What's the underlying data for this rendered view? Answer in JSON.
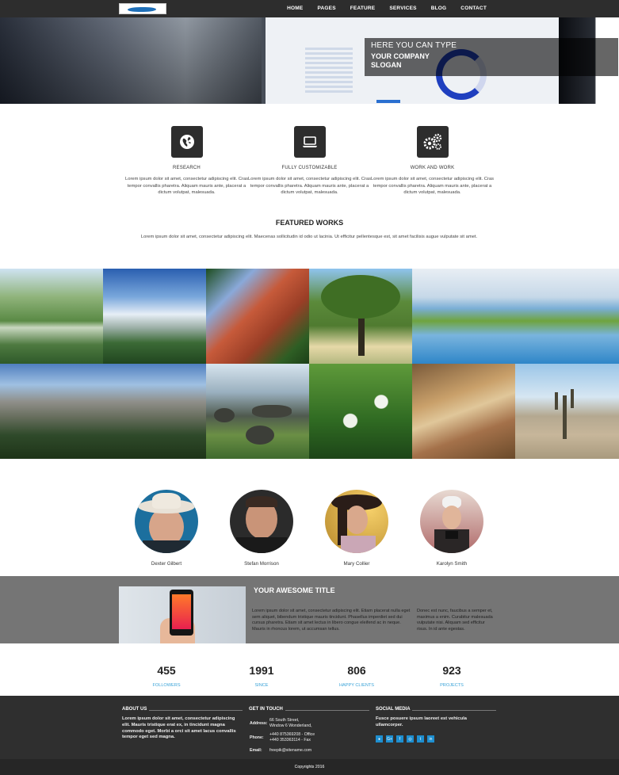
{
  "nav": {
    "menu": [
      "HOME",
      "PAGES",
      "FEATURE",
      "SERVICES",
      "BLOG",
      "CONTACT"
    ]
  },
  "hero": {
    "line1": "HERE YOU CAN TYPE",
    "line2": "YOUR COMPANY SLOGAN"
  },
  "features": [
    {
      "icon": "globe-icon",
      "title": "RESEARCH",
      "text": "Lorem ipsum dolor sit amet, consectetur adipiscing elit. Cras tempor convallis pharetra. Aliquam mauris ante, placerat a dictum volutpat, malesuada."
    },
    {
      "icon": "laptop-icon",
      "title": "FULLY CUSTOMIZABLE",
      "text": "Lorem ipsum dolor sit amet, consectetur adipiscing elit. Cras tempor convallis pharetra. Aliquam mauris ante, placerat a dictum volutpat, malesuada."
    },
    {
      "icon": "gears-icon",
      "title": "WORK AND WORK",
      "text": "Lorem ipsum dolor sit amet, consectetur adipiscing elit. Cras tempor convallis pharetra. Aliquam mauris ante, placerat a dictum volutpat, malesuada."
    }
  ],
  "featured": {
    "title": "FEATURED WORKS",
    "text": "Lorem ipsum dolor sit amet, consectetur adipiscing elit. Maecenas sollicitudin id odio ut lacinia. Ut efficitur pellentesque est, sit amet facilisis augue vulputate sit amet."
  },
  "team": [
    {
      "name": "Dexter Gilbert"
    },
    {
      "name": "Stefan Morrison"
    },
    {
      "name": "Mary Collier"
    },
    {
      "name": "Karolyn Smith"
    }
  ],
  "banner": {
    "title": "YOUR AWESOME TITLE",
    "col1": "Lorem ipsum dolor sit amet, consectetur adipiscing elit. Etiam placerat nulla eget sem aliquet, bibendum tristique mauris tincidunt. Phasellus imperdiet sed dui cursus pharetra. Etiam sit amet lectus in libero congue eleifend ac in neque. Mauris in rhoncus lorem, ut accumsan tellus.",
    "col2": "Donec est nunc, faucibus a semper et, maximus a enim. Curabitur malesuada vulputate nisi. Aliquam sed efficitur risus. In id ante egestas."
  },
  "stats": [
    {
      "num": "455",
      "label": "FOLLOWERS"
    },
    {
      "num": "1991",
      "label": "SINCE"
    },
    {
      "num": "806",
      "label": "HAPPY CLIENTS"
    },
    {
      "num": "923",
      "label": "PROJECTS"
    }
  ],
  "footer": {
    "about_title": "ABOUT US",
    "about_text": "Lorem ipsum dolor sit amet, consectetur adipiscing elit. Mauris tristique erat ex, in tincidunt magna commodo eget. Morbi a orci sit amet lacus convallis tempor eget sed magna.",
    "touch_title": "GET IN TOUCH",
    "address_label": "Address:",
    "address_line1": "66 South Street,",
    "address_line2": "Window 6 Wonderland,",
    "phone_label": "Phone:",
    "phone_line1": "+440 875369208 - Office",
    "phone_line2": "+440 353363114 - Fax",
    "email_label": "Email:",
    "email_value": "freepik@sitename.com",
    "social_title": "SOCIAL MEDIA",
    "social_text": "Fusce posuere ipsum laoreet est vehicula ullamcorper.",
    "social_icons": [
      "user-icon",
      "google-plus-icon",
      "facebook-icon",
      "dribbble-icon",
      "twitter-icon",
      "linkedin-icon"
    ],
    "copyright": "Copyrights 2016"
  },
  "colors": {
    "nav_bg": "#2d2d2d",
    "accent_blue": "#3aa3d8",
    "banner_bg": "#757575",
    "footer_bg": "#2f2f2f"
  }
}
